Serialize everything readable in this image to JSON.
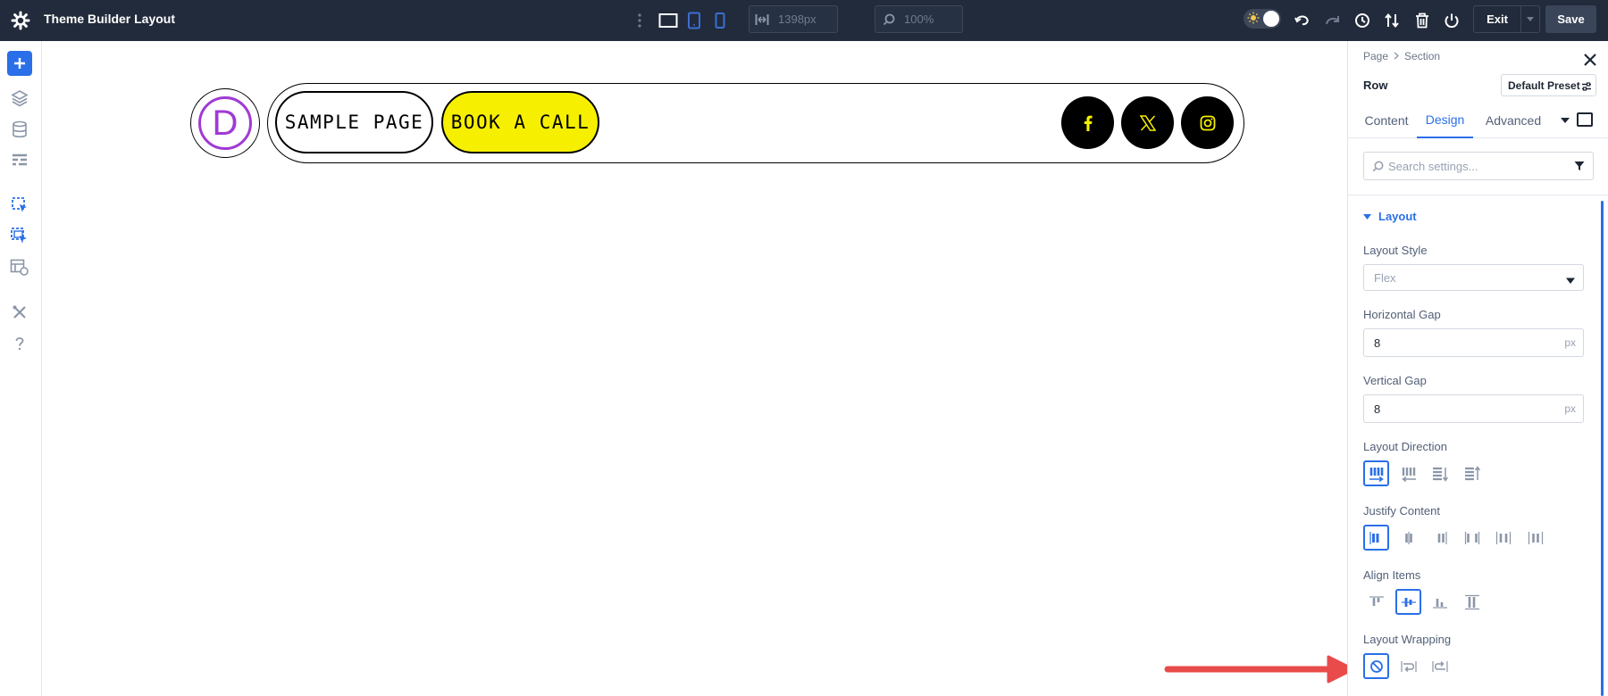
{
  "app": {
    "title": "Theme Builder Layout"
  },
  "toolbar": {
    "width_value": "1398px",
    "zoom_value": "100%",
    "exit_label": "Exit",
    "save_label": "Save"
  },
  "canvas": {
    "logo_letter": "D",
    "nav_buttons": [
      "SAMPLE PAGE",
      "BOOK A CALL"
    ],
    "social_icons": [
      "facebook-icon",
      "x-twitter-icon",
      "instagram-icon"
    ]
  },
  "panel": {
    "breadcrumb": [
      "Page",
      "Section"
    ],
    "element_title": "Row",
    "preset_label": "Default Preset",
    "tabs": [
      "Content",
      "Design",
      "Advanced"
    ],
    "active_tab": "Design",
    "search_placeholder": "Search settings...",
    "group_title": "Layout",
    "layout_style": {
      "label": "Layout Style",
      "value": "Flex"
    },
    "horizontal_gap": {
      "label": "Horizontal Gap",
      "value": "8",
      "unit": "px"
    },
    "vertical_gap": {
      "label": "Vertical Gap",
      "value": "8",
      "unit": "px"
    },
    "layout_direction": {
      "label": "Layout Direction",
      "selected_index": 0,
      "option_count": 4
    },
    "justify_content": {
      "label": "Justify Content",
      "selected_index": 0,
      "option_count": 6
    },
    "align_items": {
      "label": "Align Items",
      "selected_index": 1,
      "option_count": 4
    },
    "layout_wrapping": {
      "label": "Layout Wrapping",
      "selected_index": 0,
      "option_count": 3
    }
  },
  "colors": {
    "accent": "#2b6fe8",
    "topbar": "#222b3b",
    "brand_yellow": "#f6f000",
    "logo_purple": "#a03ad4",
    "annotation_red": "#e94b4b"
  }
}
